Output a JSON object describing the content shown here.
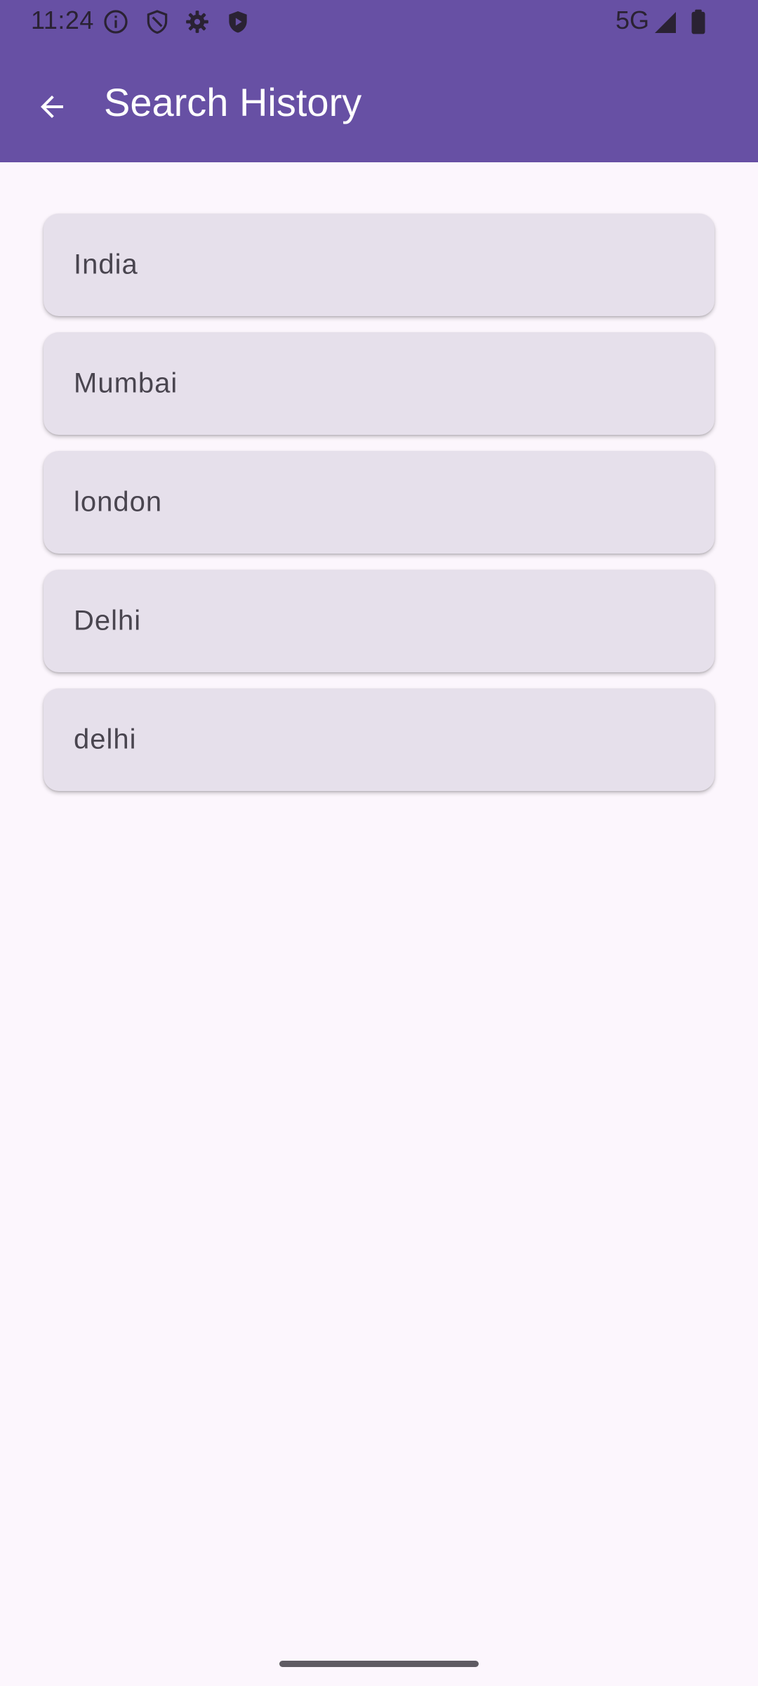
{
  "status_bar": {
    "time": "11:24",
    "network": "5G",
    "icons": [
      "info-icon",
      "shield-outline-icon",
      "gear-icon",
      "shield-play-icon",
      "signal-icon",
      "battery-icon"
    ]
  },
  "app_bar": {
    "title": "Search History",
    "back_icon": "arrow-back-icon",
    "color": "#6750a4"
  },
  "history": {
    "items": [
      {
        "label": "India"
      },
      {
        "label": "Mumbai"
      },
      {
        "label": "london"
      },
      {
        "label": "Delhi"
      },
      {
        "label": "delhi"
      }
    ]
  },
  "colors": {
    "background": "#fcf6fd",
    "card": "#e6e0eb",
    "card_text": "#49454f"
  }
}
